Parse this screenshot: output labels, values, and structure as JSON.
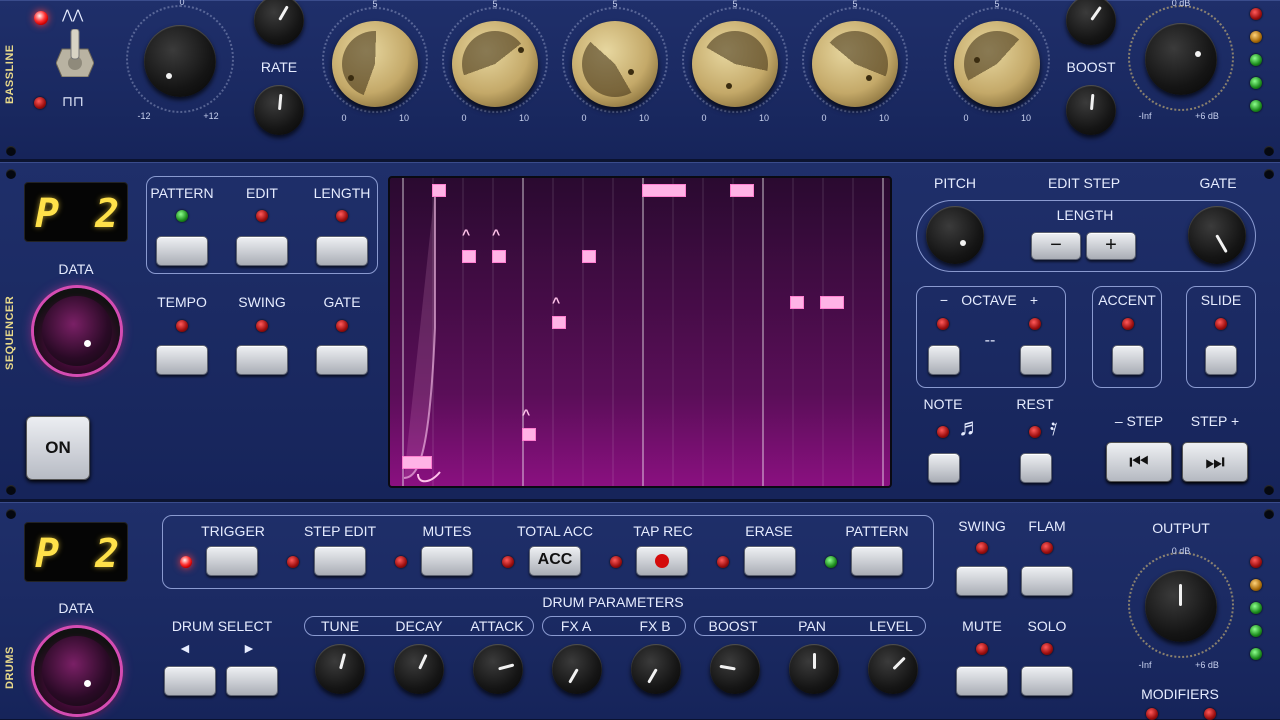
{
  "bassline": {
    "section_label": "BASSLINE",
    "wave_saw": "⋀⋀",
    "wave_square": "⊓⊓",
    "tune_min": "-12",
    "tune_max": "+12",
    "tune_top": "0",
    "rate_label": "RATE",
    "boost_label": "BOOST",
    "gold_knobs": [
      {
        "top": "5",
        "min": "0",
        "max": "10"
      },
      {
        "top": "5",
        "min": "0",
        "max": "10"
      },
      {
        "top": "5",
        "min": "0",
        "max": "10"
      },
      {
        "top": "5",
        "min": "0",
        "max": "10"
      },
      {
        "top": "5",
        "min": "0",
        "max": "10"
      },
      {
        "top": "5",
        "min": "0",
        "max": "10"
      }
    ],
    "vol_min": "-Inf",
    "vol_max": "+6 dB",
    "vol_top": "0 dB"
  },
  "sequencer": {
    "section_label": "SEQUENCER",
    "display": "P 2",
    "data_label": "DATA",
    "on_label": "ON",
    "buttons_row1": [
      "PATTERN",
      "EDIT",
      "LENGTH"
    ],
    "buttons_row2": [
      "TEMPO",
      "SWING",
      "GATE"
    ],
    "pitch_label": "PITCH",
    "edit_step_label": "EDIT  STEP",
    "gate_label": "GATE",
    "length_label": "LENGTH",
    "minus": "−",
    "plus": "+",
    "octave_minus": "−",
    "octave_label": "OCTAVE",
    "octave_plus": "+",
    "octave_value": "--",
    "accent_label": "ACCENT",
    "slide_label": "SLIDE",
    "note_label": "NOTE",
    "rest_label": "REST",
    "step_prev_label": "– STEP",
    "step_next_label": "STEP +",
    "prev_icon": "⏮",
    "next_icon": "⏭"
  },
  "drums": {
    "section_label": "DRUMS",
    "display": "P 2",
    "data_label": "DATA",
    "mode_buttons": [
      "TRIGGER",
      "STEP EDIT",
      "MUTES",
      "TOTAL ACC",
      "TAP REC",
      "ERASE",
      "PATTERN"
    ],
    "acc_label": "ACC",
    "drum_params_label": "DRUM  PARAMETERS",
    "drum_select": "DRUM   SELECT",
    "left_arrow": "◄",
    "right_arrow": "►",
    "params": [
      "TUNE",
      "DECAY",
      "ATTACK",
      "FX A",
      "FX B",
      "BOOST",
      "PAN",
      "LEVEL"
    ],
    "swing_label": "SWING",
    "flam_label": "FLAM",
    "mute_label": "MUTE",
    "solo_label": "SOLO",
    "output_label": "OUTPUT",
    "out_top": "0 dB",
    "out_min": "-Inf",
    "out_max": "+6 dB",
    "modifiers_label": "MODIFIERS"
  }
}
